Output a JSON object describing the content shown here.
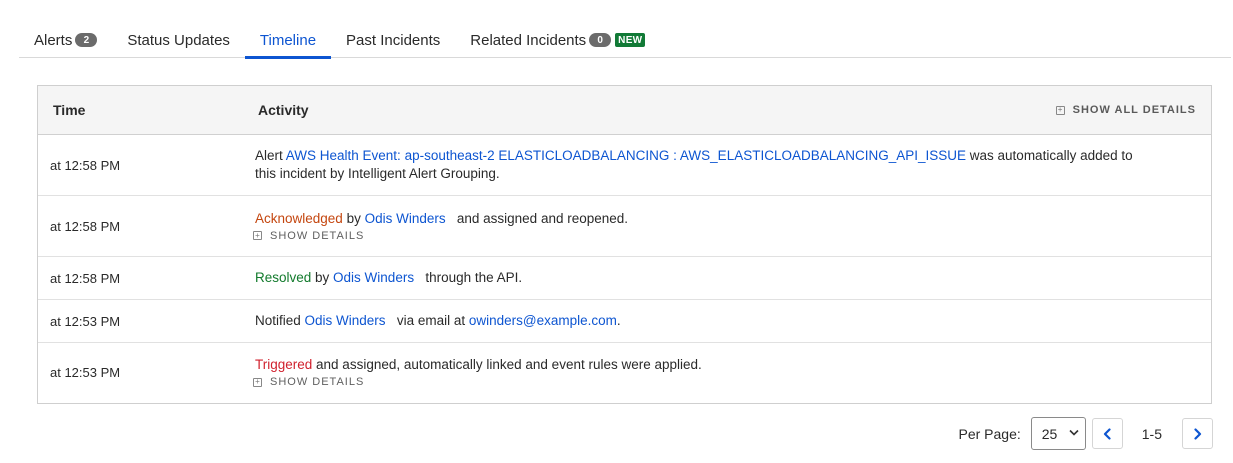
{
  "tabs": [
    {
      "label": "Alerts",
      "count": "2"
    },
    {
      "label": "Status Updates"
    },
    {
      "label": "Timeline"
    },
    {
      "label": "Past Incidents"
    },
    {
      "label": "Related Incidents",
      "count": "0",
      "badge": "NEW"
    }
  ],
  "active_tab": "Timeline",
  "table": {
    "headers": {
      "time": "Time",
      "activity": "Activity"
    },
    "show_all_details": "SHOW ALL DETAILS",
    "show_details": "SHOW DETAILS",
    "rows": [
      {
        "time": "at 12:58 PM",
        "prefix": "Alert ",
        "link": "AWS Health Event: ap-southeast-2 ELASTICLOADBALANCING : AWS_ELASTICLOADBALANCING_API_ISSUE",
        "suffix": " was automatically added to this incident by Intelligent Alert Grouping."
      },
      {
        "time": "at 12:58 PM",
        "status": "Acknowledged",
        "by": " by ",
        "user": "Odis Winders",
        "rest": "and assigned and reopened."
      },
      {
        "time": "at 12:58 PM",
        "status": "Resolved",
        "by": " by ",
        "user": "Odis Winders",
        "rest": "through the API."
      },
      {
        "time": "at 12:53 PM",
        "prefix": "Notified ",
        "user": "Odis Winders",
        "mid": "via email at ",
        "email": "owinders@example.com",
        "end": "."
      },
      {
        "time": "at 12:53 PM",
        "status": "Triggered",
        "rest": " and assigned, automatically linked and event rules were applied."
      }
    ]
  },
  "pagination": {
    "per_page_label": "Per Page:",
    "per_page_value": "25",
    "range": "1-5"
  },
  "colors": {
    "link": "#0d55d1",
    "acknowledged": "#c4460f",
    "resolved": "#127a2c",
    "triggered": "#d0212e",
    "new_badge": "#117a36"
  }
}
